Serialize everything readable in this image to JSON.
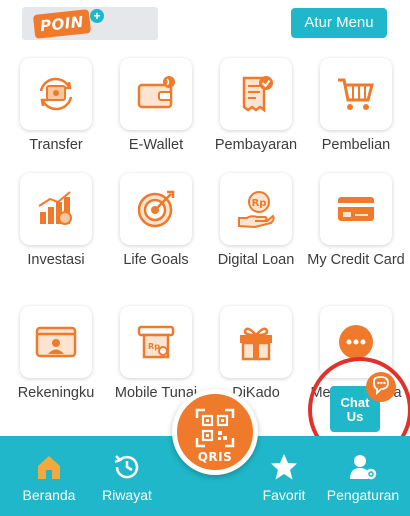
{
  "header": {
    "poin_logo_text": "POIN",
    "poin_plus": "+",
    "atur_menu_label": "Atur Menu"
  },
  "menu": [
    {
      "label": "Transfer",
      "icon": "transfer-icon"
    },
    {
      "label": "E-Wallet",
      "icon": "wallet-icon"
    },
    {
      "label": "Pembayaran",
      "icon": "bill-payment-icon"
    },
    {
      "label": "Pembelian",
      "icon": "shopping-cart-icon"
    },
    {
      "label": "Investasi",
      "icon": "investment-chart-icon"
    },
    {
      "label": "Life Goals",
      "icon": "target-icon"
    },
    {
      "label": "Digital Loan",
      "icon": "loan-hand-icon"
    },
    {
      "label": "My Credit Card",
      "icon": "credit-card-icon"
    },
    {
      "label": "Rekeningku",
      "icon": "account-card-icon"
    },
    {
      "label": "Mobile Tunai",
      "icon": "atm-cash-icon"
    },
    {
      "label": "DiKado",
      "icon": "gift-icon"
    },
    {
      "label": "Menu Lainnya",
      "icon": "more-icon"
    }
  ],
  "qris": {
    "label": "QRIS"
  },
  "bottom_nav": [
    {
      "label": "Beranda",
      "icon": "home-icon"
    },
    {
      "label": "Riwayat",
      "icon": "history-icon"
    },
    {
      "label": "Favorit",
      "icon": "star-icon"
    },
    {
      "label": "Pengaturan",
      "icon": "settings-user-icon"
    }
  ],
  "chat": {
    "label_line1": "Chat",
    "label_line2": "Us"
  },
  "colors": {
    "accent": "#1fb7c9",
    "orange": "#ef7a2c",
    "highlight_ring": "#e0322b"
  }
}
